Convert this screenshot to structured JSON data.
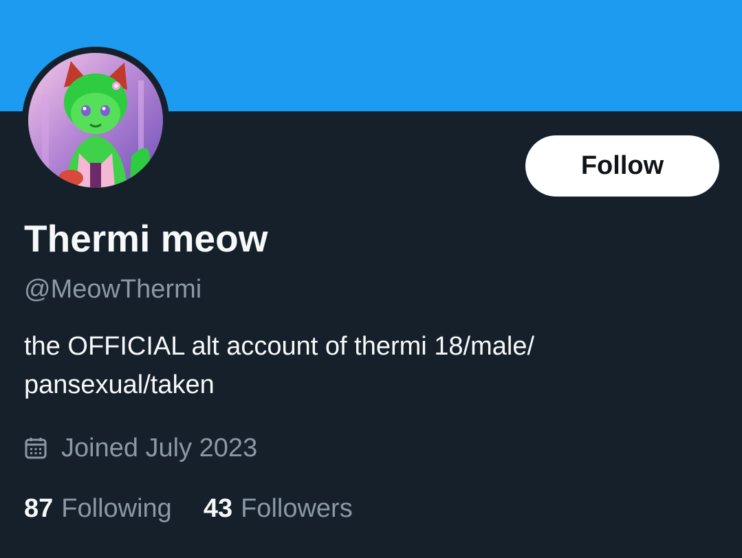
{
  "profile": {
    "display_name": "Thermi meow",
    "handle": "@MeowThermi",
    "bio_line1": "the OFFICIAL alt account of thermi 18/male/",
    "bio_line2": "pansexual/taken",
    "joined": "Joined July 2023"
  },
  "actions": {
    "follow_label": "Follow"
  },
  "stats": {
    "following_count": "87",
    "following_label": "Following",
    "followers_count": "43",
    "followers_label": "Followers"
  },
  "colors": {
    "banner": "#1d9bf0",
    "background": "#15202b",
    "primary_text": "#f7f9f9",
    "secondary_text": "#8b98a5",
    "button_bg": "#ffffff"
  },
  "icons": {
    "joined": "calendar-icon",
    "avatar": "furry-character-avatar"
  }
}
